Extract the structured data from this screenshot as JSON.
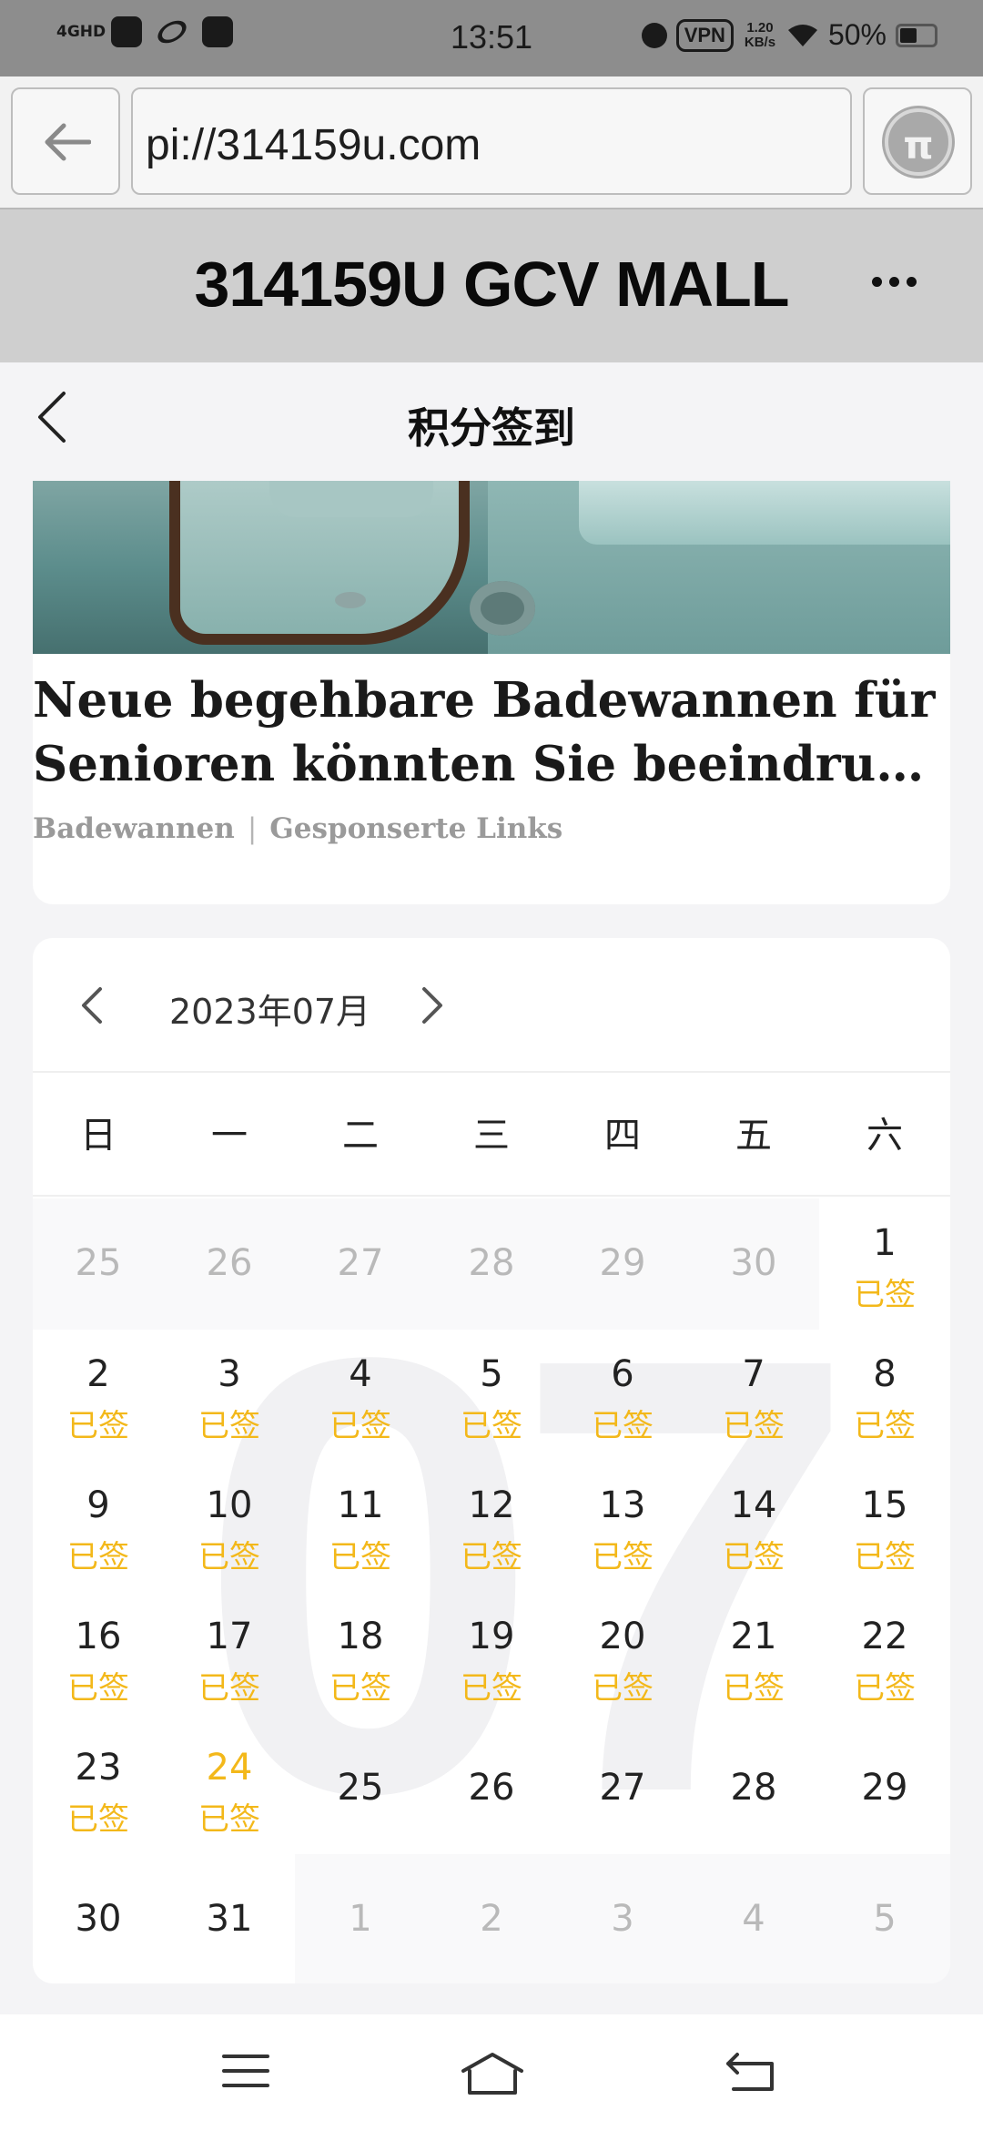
{
  "status_bar": {
    "network": "4GHD",
    "time": "13:51",
    "vpn": "VPN",
    "speed_value": "1.20",
    "speed_unit": "KB/s",
    "battery": "50%"
  },
  "browser": {
    "url": "pi://314159u.com",
    "pi_logo": "π"
  },
  "mall": {
    "title": "314159U GCV MALL"
  },
  "page": {
    "title": "积分签到"
  },
  "ad": {
    "title_line1": "Neue begehbare Badewannen für",
    "title_line2": "Senioren könnten Sie beeindrucke...",
    "source": "Badewannen",
    "separator": "|",
    "label": "Gesponserte Links"
  },
  "calendar": {
    "month_label": "2023年07月",
    "watermark": "07",
    "weekdays": [
      "日",
      "一",
      "二",
      "三",
      "四",
      "五",
      "六"
    ],
    "signed_label": "已签",
    "days": [
      {
        "n": "25",
        "other": true
      },
      {
        "n": "26",
        "other": true
      },
      {
        "n": "27",
        "other": true
      },
      {
        "n": "28",
        "other": true
      },
      {
        "n": "29",
        "other": true
      },
      {
        "n": "30",
        "other": true
      },
      {
        "n": "1",
        "signed": true
      },
      {
        "n": "2",
        "signed": true
      },
      {
        "n": "3",
        "signed": true
      },
      {
        "n": "4",
        "signed": true
      },
      {
        "n": "5",
        "signed": true
      },
      {
        "n": "6",
        "signed": true
      },
      {
        "n": "7",
        "signed": true
      },
      {
        "n": "8",
        "signed": true
      },
      {
        "n": "9",
        "signed": true
      },
      {
        "n": "10",
        "signed": true
      },
      {
        "n": "11",
        "signed": true
      },
      {
        "n": "12",
        "signed": true
      },
      {
        "n": "13",
        "signed": true
      },
      {
        "n": "14",
        "signed": true
      },
      {
        "n": "15",
        "signed": true
      },
      {
        "n": "16",
        "signed": true
      },
      {
        "n": "17",
        "signed": true
      },
      {
        "n": "18",
        "signed": true
      },
      {
        "n": "19",
        "signed": true
      },
      {
        "n": "20",
        "signed": true
      },
      {
        "n": "21",
        "signed": true
      },
      {
        "n": "22",
        "signed": true
      },
      {
        "n": "23",
        "signed": true
      },
      {
        "n": "24",
        "signed": true,
        "today": true
      },
      {
        "n": "25"
      },
      {
        "n": "26"
      },
      {
        "n": "27"
      },
      {
        "n": "28"
      },
      {
        "n": "29"
      },
      {
        "n": "30"
      },
      {
        "n": "31"
      },
      {
        "n": "1",
        "other": true
      },
      {
        "n": "2",
        "other": true
      },
      {
        "n": "3",
        "other": true
      },
      {
        "n": "4",
        "other": true
      },
      {
        "n": "5",
        "other": true
      }
    ]
  },
  "colors": {
    "signed": "#f3b81a",
    "status_bar": "#8d8d8d",
    "mall_header": "#cfcfcf"
  },
  "icons": {
    "nav_back": "arrow-left-icon",
    "page_back": "chevron-left-icon",
    "menu": "menu-icon",
    "home": "home-icon",
    "system_back": "back-icon"
  }
}
